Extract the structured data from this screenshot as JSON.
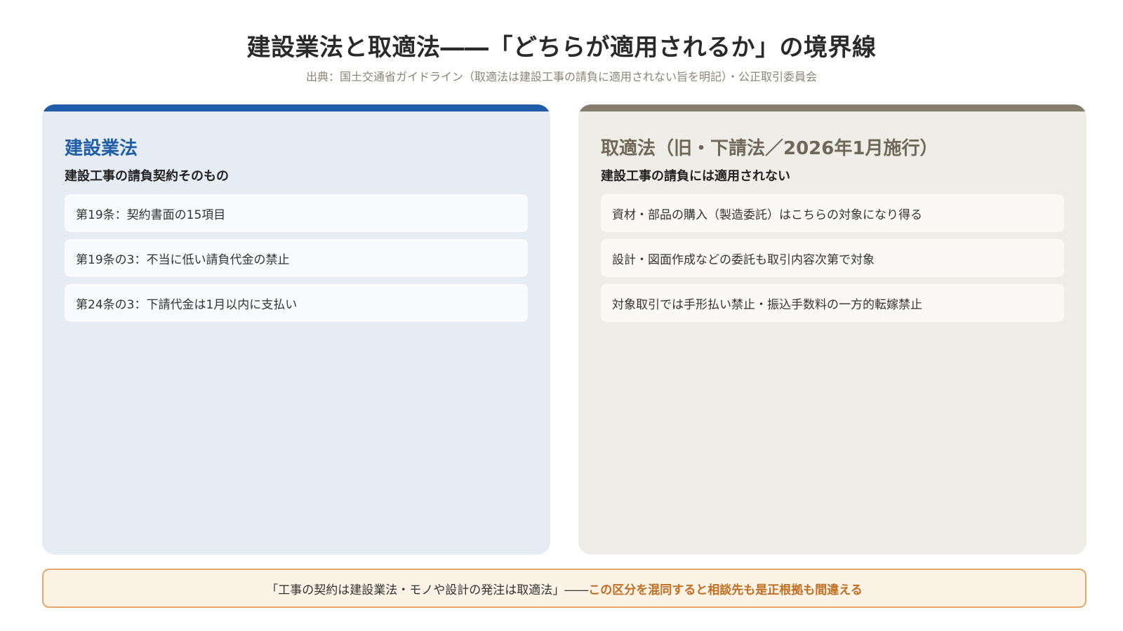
{
  "header": {
    "title": "建設業法と取適法――「どちらが適用されるか」の境界線",
    "source": "出典：国土交通省ガイドライン（取適法は建設工事の請負に適用されない旨を明記）・公正取引委員会"
  },
  "left_panel": {
    "title": "建設業法",
    "subtitle": "建設工事の請負契約そのもの",
    "accent_color": "#1f5da8",
    "items": [
      "第19条：契約書面の15項目",
      "第19条の3：不当に低い請負代金の禁止",
      "第24条の3：下請代金は1月以内に支払い"
    ]
  },
  "right_panel": {
    "title": "取適法（旧・下請法／2026年1月施行）",
    "subtitle": "建設工事の請負には適用されない",
    "accent_color": "#857c6c",
    "items": [
      "資材・部品の購入（製造委託）はこちらの対象になり得る",
      "設計・図面作成などの委託も取引内容次第で対象",
      "対象取引では手形払い禁止・振込手数料の一方的転嫁禁止"
    ]
  },
  "footer": {
    "text": "「工事の契約は建設業法・モノや設計の発注は取適法」――",
    "emphasis": "この区分を混同すると相談先も是正根拠も間違える",
    "accent_color": "#c06f22"
  }
}
